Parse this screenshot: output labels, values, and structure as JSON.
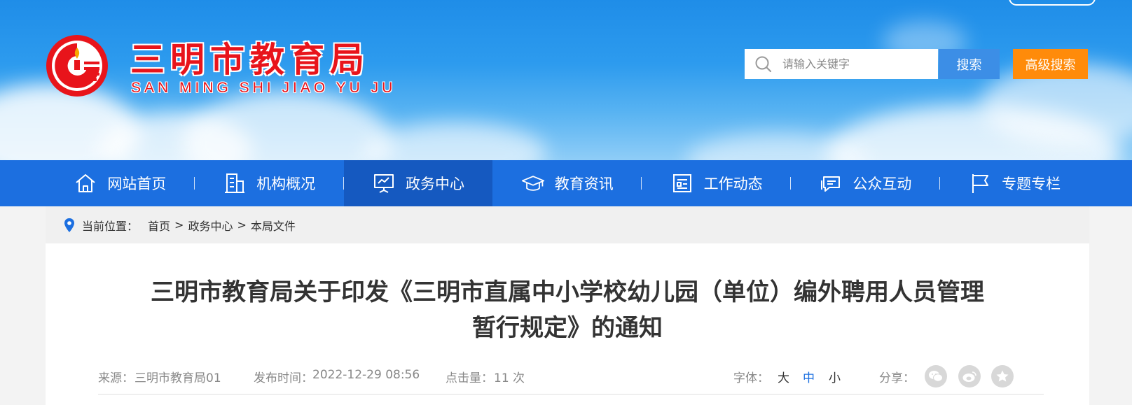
{
  "header": {
    "site_name": "三明市教育局",
    "site_name_pinyin": "SAN MING SHI JIAO YU JU",
    "search_placeholder": "请输入关键字",
    "search_button": "搜索",
    "advanced_search_button": "高级搜索"
  },
  "nav": {
    "items": [
      {
        "label": "网站首页",
        "icon": "home-icon"
      },
      {
        "label": "机构概况",
        "icon": "building-icon"
      },
      {
        "label": "政务中心",
        "icon": "presentation-icon",
        "active": true
      },
      {
        "label": "教育资讯",
        "icon": "graduation-cap-icon"
      },
      {
        "label": "工作动态",
        "icon": "document-list-icon"
      },
      {
        "label": "公众互动",
        "icon": "chat-icon"
      },
      {
        "label": "专题专栏",
        "icon": "flag-icon"
      }
    ]
  },
  "breadcrumb": {
    "label": "当前位置：",
    "items": [
      "首页",
      ">",
      "政务中心",
      ">",
      "本局文件"
    ]
  },
  "article": {
    "title_line1": "三明市教育局关于印发《三明市直属中小学校幼儿园（单位）编外聘用人员管理",
    "title_line2": "暂行规定》的通知",
    "source_label": "来源：",
    "source": "三明市教育局01",
    "published_label": "发布时间：",
    "published": "2022-12-29 08:56",
    "clicks_label": "点击量：",
    "clicks": "11 次",
    "font_label": "字体：",
    "font_large": "大",
    "font_medium": "中",
    "font_small": "小",
    "share_label": "分享："
  },
  "colors": {
    "brand_red": "#e8141b",
    "nav_blue": "#1c6fe0",
    "nav_active": "#1559c0",
    "search_blue": "#3c8ee6",
    "advanced_orange": "#ff8b0a"
  }
}
